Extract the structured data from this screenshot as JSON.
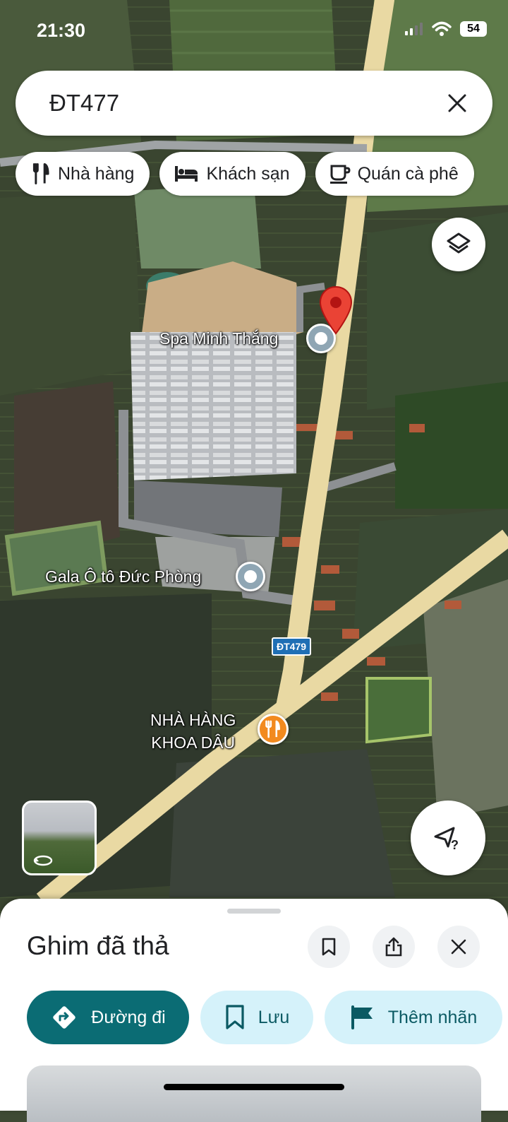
{
  "status_bar": {
    "time": "21:30",
    "battery": "54"
  },
  "search": {
    "query": "ĐT477"
  },
  "chips": [
    {
      "label": "Nhà hàng",
      "icon": "fork-knife-icon"
    },
    {
      "label": "Khách sạn",
      "icon": "bed-icon"
    },
    {
      "label": "Quán cà phê",
      "icon": "coffee-cup-icon"
    }
  ],
  "map": {
    "places": {
      "spa": "Spa Minh Thắng",
      "car_gallery": "Gala Ô tô Đức Phòng",
      "restaurant_line1": "NHÀ HÀNG",
      "restaurant_line2": "KHOA DÂU"
    },
    "road_shield": "ĐT479",
    "colors": {
      "pin_red": "#ea4335",
      "road": "#e9d9a3",
      "poi_gray": "#8fa6b4",
      "poi_orange": "#f28a1f"
    }
  },
  "sheet": {
    "title": "Ghim đã thả",
    "actions": {
      "directions": "Đường đi",
      "save": "Lưu",
      "label": "Thêm nhãn"
    },
    "colors": {
      "primary": "#0b6c74",
      "secondary_bg": "#d5f2fa"
    }
  }
}
